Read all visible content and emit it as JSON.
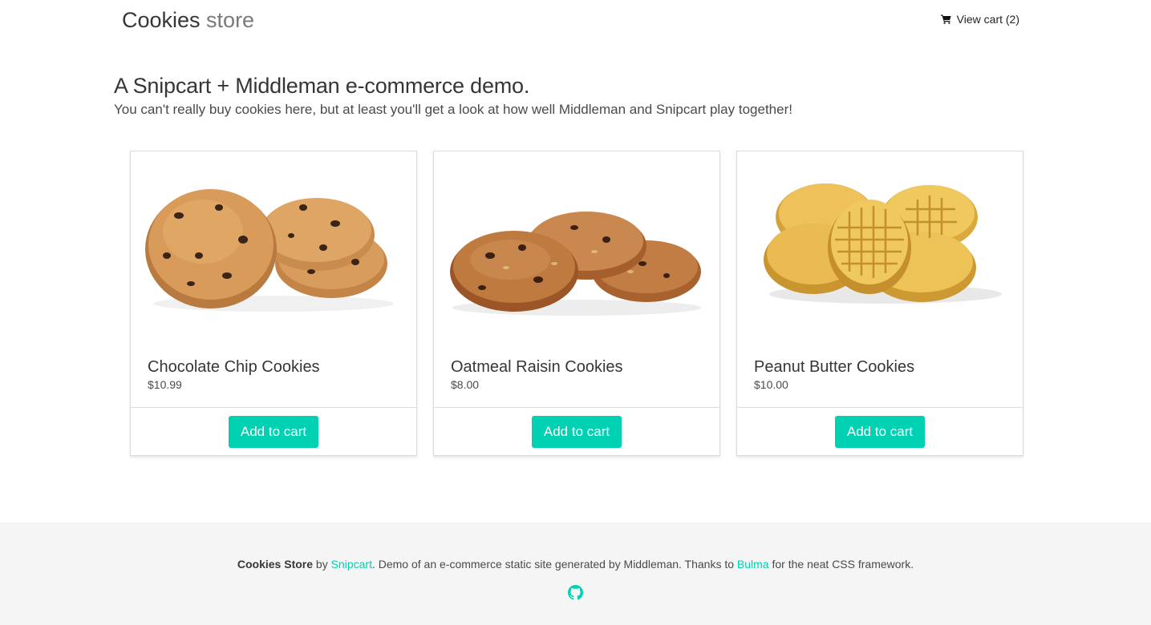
{
  "header": {
    "brand_main": "Cookies",
    "brand_sub": " store",
    "cart_label": "View cart (2)",
    "cart_icon": "shopping-cart-icon"
  },
  "hero": {
    "title": "A Snipcart + Middleman e-commerce demo.",
    "subtitle": "You can't really buy cookies here, but at least you'll get a look at how well Middleman and Snipcart play together!"
  },
  "products": [
    {
      "name": "Chocolate Chip Cookies",
      "price": "$10.99",
      "button": "Add to cart",
      "image": "chocolate-chip-cookies-image"
    },
    {
      "name": "Oatmeal Raisin Cookies",
      "price": "$8.00",
      "button": "Add to cart",
      "image": "oatmeal-raisin-cookies-image"
    },
    {
      "name": "Peanut Butter Cookies",
      "price": "$10.00",
      "button": "Add to cart",
      "image": "peanut-butter-cookies-image"
    }
  ],
  "footer": {
    "brand": "Cookies Store",
    "by": " by ",
    "snipcart_link": "Snipcart",
    "middle": ". Demo of an e-commerce static site generated by Middleman. Thanks to ",
    "bulma_link": "Bulma",
    "end": " for the neat CSS framework.",
    "github_icon": "github-icon"
  },
  "colors": {
    "accent": "#00d1b2",
    "text": "#363636",
    "footer_bg": "#f5f5f5",
    "border": "#dbdbdb"
  }
}
